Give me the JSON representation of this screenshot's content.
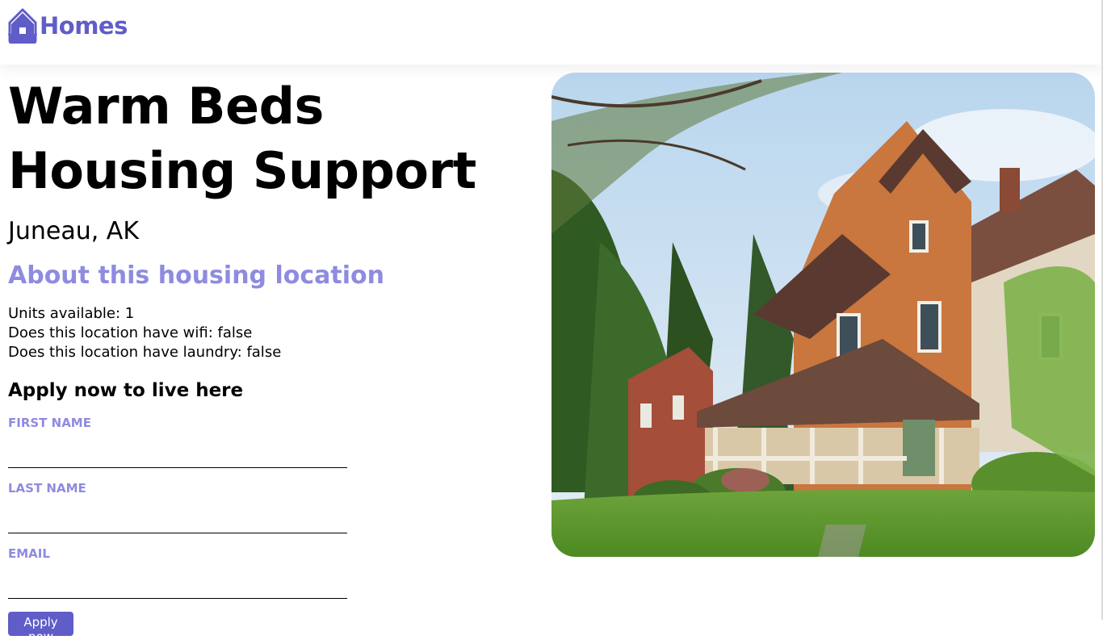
{
  "header": {
    "logo_text": "Homes",
    "brand_color": "#605dc8",
    "logo_icon": "house-icon"
  },
  "listing": {
    "name": "Warm Beds Housing Support",
    "location": "Juneau, AK",
    "about_heading": "About this housing location",
    "features": [
      "Units available: 1",
      "Does this location have wifi: false",
      "Does this location have laundry: false"
    ],
    "photo_description": "house-photo"
  },
  "form": {
    "heading": "Apply now to live here",
    "first_name_label": "FIRST NAME",
    "first_name_value": "",
    "last_name_label": "LAST NAME",
    "last_name_value": "",
    "email_label": "EMAIL",
    "email_value": "",
    "submit_label": "Apply now",
    "label_color": "#8e8be0"
  }
}
